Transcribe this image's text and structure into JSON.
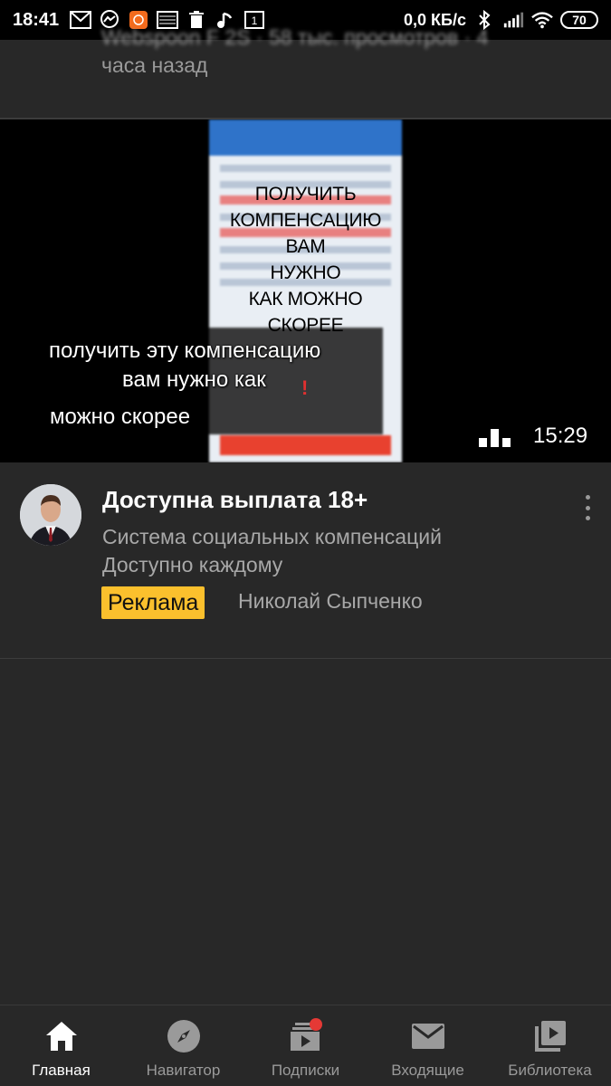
{
  "status_bar": {
    "time": "18:41",
    "network_speed": "0,0 КБ/с",
    "battery": "70",
    "icons": [
      "gmail-icon",
      "messenger-icon",
      "app-icon",
      "image-icon",
      "trash-icon",
      "music-icon",
      "notification-icon",
      "bluetooth-icon",
      "signal-icon",
      "wifi-icon"
    ]
  },
  "previous_video": {
    "meta_cut": "Webspoon F 2S · 58 тыс. просмотров · 4",
    "meta_line2": "часа назад"
  },
  "video": {
    "overlay_lines": [
      "ПОЛУЧИТЬ",
      "КОМПЕНСАЦИЮ",
      "ВАМ",
      "НУЖНО",
      "КАК МОЖНО",
      "СКОРЕЕ"
    ],
    "caption_line1": "получить эту компенсацию",
    "caption_line2": "вам нужно как",
    "caption_line3": "можно скорее",
    "duration": "15:29"
  },
  "ad": {
    "title": "Доступна выплата 18+",
    "line1": "Система социальных компенсаций",
    "line2": "Доступно каждому",
    "badge": "Реклама",
    "author": "Николай Сыпченко"
  },
  "bottom_nav": {
    "items": [
      {
        "label": "Главная",
        "icon": "home-icon",
        "active": true
      },
      {
        "label": "Навигатор",
        "icon": "compass-icon",
        "active": false
      },
      {
        "label": "Подписки",
        "icon": "subscriptions-icon",
        "active": false
      },
      {
        "label": "Входящие",
        "icon": "mail-icon",
        "active": false
      },
      {
        "label": "Библиотека",
        "icon": "library-icon",
        "active": false
      }
    ]
  },
  "colors": {
    "background": "#282828",
    "ad_badge": "#fbc02d",
    "notification_dot": "#e53935"
  }
}
